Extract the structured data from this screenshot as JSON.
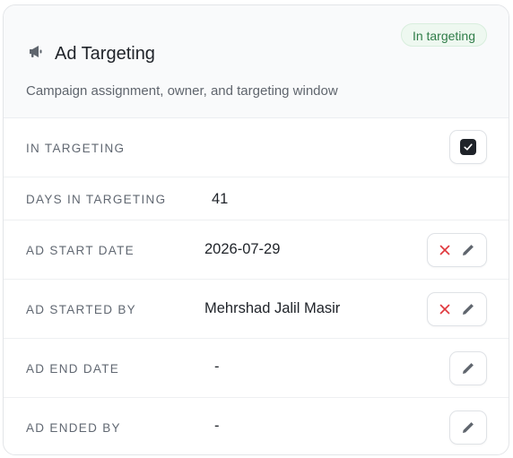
{
  "card": {
    "title": "Ad Targeting",
    "subtitle": "Campaign assignment, owner, and targeting window",
    "badge": "In targeting",
    "title_icon": "megaphone-icon",
    "badge_color": "#2f7d48"
  },
  "fields": {
    "in_targeting": {
      "label": "IN TARGETING",
      "checked": true
    },
    "days_in_targeting": {
      "label": "DAYS IN TARGETING",
      "value": "41"
    },
    "ad_start_date": {
      "label": "AD START DATE",
      "value": "2026-07-29"
    },
    "ad_started_by": {
      "label": "AD STARTED BY",
      "value": "Mehrshad Jalil Masir"
    },
    "ad_end_date": {
      "label": "AD END DATE",
      "value": "-"
    },
    "ad_ended_by": {
      "label": "AD ENDED BY",
      "value": "-"
    }
  },
  "icons": {
    "clear": "x-icon",
    "edit": "pencil-icon",
    "check": "check-icon"
  },
  "colors": {
    "clear_red": "#e0393e",
    "edit_gray": "#5f656d",
    "checkbox_dark": "#1f2329"
  }
}
